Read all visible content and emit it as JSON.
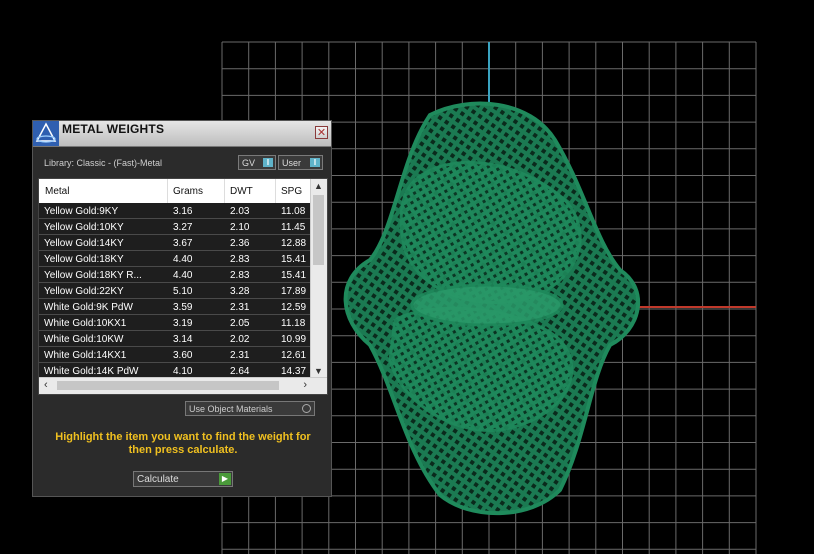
{
  "panel": {
    "title": "METAL WEIGHTS",
    "close_glyph": "✕",
    "library": "Library: Classic - (Fast)-Metal",
    "toggles": [
      {
        "label": "GV",
        "state": "I"
      },
      {
        "label": "User",
        "state": "I"
      }
    ],
    "columns": [
      "Metal",
      "Grams",
      "DWT",
      "SPG"
    ],
    "rows": [
      [
        "Yellow Gold:9KY",
        "3.16",
        "2.03",
        "11.08"
      ],
      [
        "Yellow Gold:10KY",
        "3.27",
        "2.10",
        "11.45"
      ],
      [
        "Yellow Gold:14KY",
        "3.67",
        "2.36",
        "12.88"
      ],
      [
        "Yellow Gold:18KY",
        "4.40",
        "2.83",
        "15.41"
      ],
      [
        "Yellow Gold:18KY R...",
        "4.40",
        "2.83",
        "15.41"
      ],
      [
        "Yellow Gold:22KY",
        "5.10",
        "3.28",
        "17.89"
      ],
      [
        "White Gold:9K PdW",
        "3.59",
        "2.31",
        "12.59"
      ],
      [
        "White Gold:10KX1",
        "3.19",
        "2.05",
        "11.18"
      ],
      [
        "White Gold:10KW",
        "3.14",
        "2.02",
        "10.99"
      ],
      [
        "White Gold:14KX1",
        "3.60",
        "2.31",
        "12.61"
      ],
      [
        "White Gold:14K PdW",
        "4.10",
        "2.64",
        "14.37"
      ]
    ],
    "use_materials_label": "Use Object Materials",
    "hint": "Highlight the item you want to find the weight for then press calculate.",
    "calculate_label": "Calculate"
  },
  "colors": {
    "model": "#1f8a5c",
    "grid": "#6a6a6a",
    "axis_x": "#c0392b",
    "axis_y": "#3aa3c0",
    "hint": "#f0c020"
  }
}
